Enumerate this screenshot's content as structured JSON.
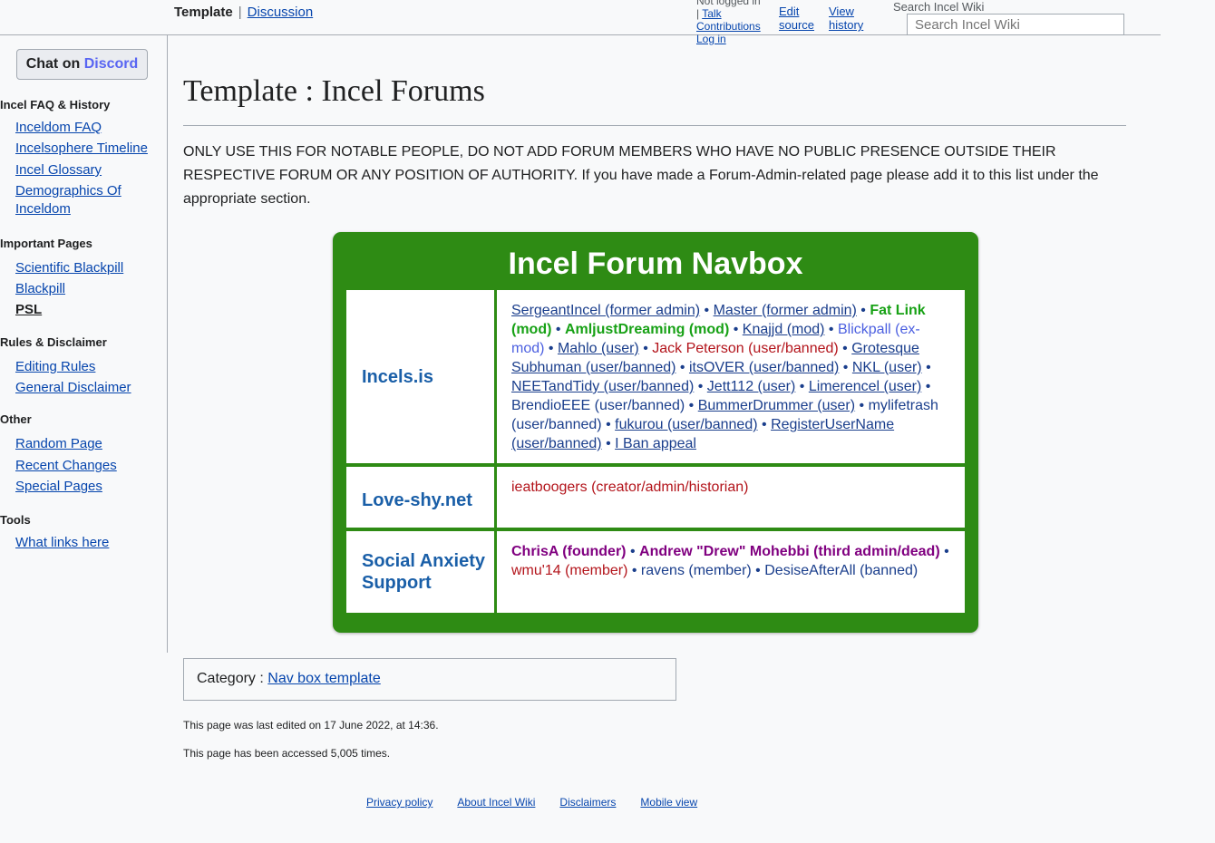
{
  "header": {
    "tab_template": "Template",
    "tab_discussion": "Discussion",
    "not_logged": "Not logged in",
    "talk": "Talk",
    "contributions": "Contributions",
    "login": "Log in",
    "edit_source": [
      "Edit",
      "source"
    ],
    "view_history": [
      "View",
      "history"
    ],
    "search_label": "Search Incel Wiki",
    "search_placeholder": "Search Incel Wiki"
  },
  "sidebar": {
    "discord": {
      "chat": "Chat on",
      "discord": "Discord"
    },
    "sections": [
      {
        "title": "Incel FAQ & History",
        "items": [
          "Inceldom FAQ",
          "Incelsophere Timeline",
          "Incel Glossary",
          "Demographics Of",
          "Inceldom"
        ]
      },
      {
        "title": "Important Pages",
        "items": [
          "Scientific Blackpill",
          "Blackpill",
          "PSL"
        ]
      },
      {
        "title": "Rules & Disclaimer",
        "items": [
          "Editing Rules",
          "General Disclaimer"
        ]
      },
      {
        "title": "Other",
        "items": [
          "Random Page",
          "Recent Changes",
          "Special Pages"
        ]
      },
      {
        "title": "Tools",
        "items": [
          "What links here"
        ]
      }
    ]
  },
  "page": {
    "title": "Template : Incel Forums",
    "intro": "ONLY USE THIS FOR NOTABLE PEOPLE, DO NOT ADD FORUM MEMBERS WHO HAVE NO PUBLIC PRESENCE OUTSIDE THEIR RESPECTIVE FORUM OR ANY POSITION OF AUTHORITY. If you have made a Forum-Admin-related page please add it to this list under the appropriate section."
  },
  "navbox": {
    "title": "Incel Forum Navbox",
    "rows": [
      {
        "label": "Incels.is",
        "items": [
          {
            "t": "SergeantIncel (former admin)",
            "c": "a"
          },
          {
            "t": "Master (former admin)",
            "c": "a"
          },
          {
            "t": "Fat Link (mod)",
            "c": "g"
          },
          {
            "t": "AmljustDreaming (mod)",
            "c": "g"
          },
          {
            "t": "Knajjd (mod)",
            "c": "a"
          },
          {
            "t": "Blickpall (ex-mod)",
            "c": "bl"
          },
          {
            "t": "Mahlo (user)",
            "c": "a"
          },
          {
            "t": "Jack Peterson (user/banned)",
            "c": "r"
          },
          {
            "t": "Grotesque Subhuman (user/banned)",
            "c": "a"
          },
          {
            "t": "itsOVER (user/banned)",
            "c": "a"
          },
          {
            "t": "NKL (user)",
            "c": "a"
          },
          {
            "t": "NEETandTidy (user/banned)",
            "c": "a"
          },
          {
            "t": "Jett112 (user)",
            "c": "a"
          },
          {
            "t": "Limerencel (user)",
            "c": "a"
          },
          {
            "t": "BrendioEEE (user/banned)",
            "c": "nb"
          },
          {
            "t": "BummerDrummer (user)",
            "c": "a"
          },
          {
            "t": "mylifetrash (user/banned)",
            "c": "nb"
          },
          {
            "t": "fukurou (user/banned)",
            "c": "a"
          },
          {
            "t": "RegisterUserName (user/banned)",
            "c": "a"
          },
          {
            "t": "I Ban appeal",
            "c": "a"
          }
        ]
      },
      {
        "label": "Love-shy.net",
        "items": [
          {
            "t": "ieatboogers (creator/admin/historian)",
            "c": "r"
          }
        ]
      },
      {
        "label": "Social Anxiety Support",
        "items": [
          {
            "t": "ChrisA (founder)",
            "c": "p"
          },
          {
            "t": "Andrew \"Drew\" Mohebbi (third admin/dead)",
            "c": "p"
          },
          {
            "t": "wmu'14 (member)",
            "c": "r"
          },
          {
            "t": "ravens (member)",
            "c": "nb"
          },
          {
            "t": "DesiseAfterAll (banned)",
            "c": "nb"
          }
        ]
      }
    ]
  },
  "category": {
    "label": "Category :",
    "link": "Nav box template"
  },
  "footer": {
    "edited": "This page was last edited on 17 June 2022, at 14:36.",
    "accessed": "This page has been accessed 5,005 times.",
    "links": [
      "Privacy policy",
      "About Incel Wiki",
      "Disclaimers",
      "Mobile view"
    ]
  }
}
